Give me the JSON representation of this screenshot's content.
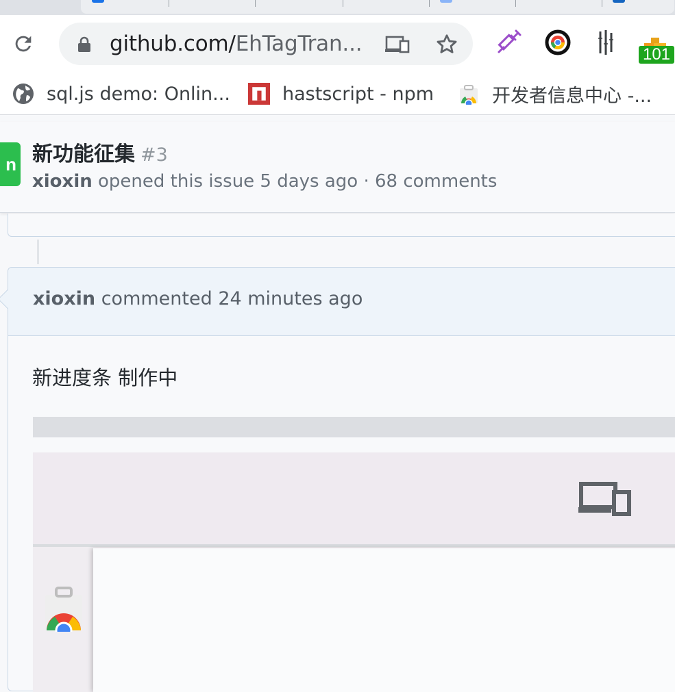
{
  "browser": {
    "url_host": "github.com/",
    "url_path": "EhTagTran...",
    "extension_badge": "101"
  },
  "bookmarks": [
    {
      "label": "sql.js demo: Onlin...",
      "icon": "globe-icon"
    },
    {
      "label": "hastscript - npm",
      "icon": "npm-icon"
    },
    {
      "label": "开发者信息中心 -...",
      "icon": "chrome-webstore-icon"
    }
  ],
  "issue": {
    "state_glyph": "n",
    "title": "新功能征集",
    "number": "#3",
    "author": "xioxin",
    "meta_text": " opened this issue 5 days ago · 68 comments"
  },
  "comment": {
    "author": "xioxin",
    "meta_text": " commented 24 minutes ago",
    "body": "新进度条 制作中",
    "progress_fraction": 0
  },
  "colors": {
    "open_state": "#2cbe4e",
    "badge": "#1ea51e",
    "comment_header": "#eef4fa"
  }
}
